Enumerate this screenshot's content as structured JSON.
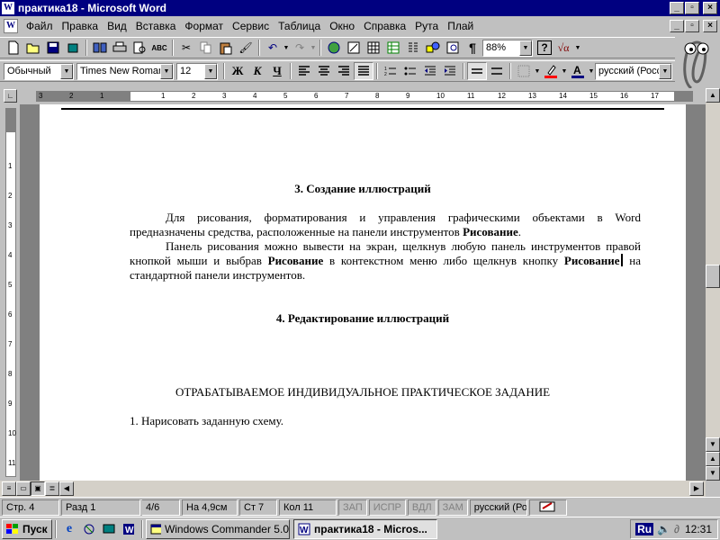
{
  "window": {
    "title": "практика18 - Microsoft Word",
    "icon": "word-icon"
  },
  "menu": [
    "Файл",
    "Правка",
    "Вид",
    "Вставка",
    "Формат",
    "Сервис",
    "Таблица",
    "Окно",
    "Справка",
    "Рута",
    "Плай"
  ],
  "standard_toolbar": {
    "zoom": "88%"
  },
  "format_toolbar": {
    "style": "Обычный",
    "font": "Times New Roman",
    "size": "12",
    "bold": "Ж",
    "italic": "К",
    "underline": "Ч",
    "language": "русский (Росс"
  },
  "document": {
    "heading1": "3. Создание иллюстраций",
    "para1": "Для рисования, форматирования и управления графическими объектами в Word предназначены средства, расположенные на панели инструментов",
    "para1_bold": "Рисование",
    "para2_a": "Панель рисования можно вывести на экран, щелкнув любую панель инструментов правой кнопкой мыши и выбрав",
    "para2_bold1": "Рисование",
    "para2_b": "в контекстном меню либо щелкнув кнопку",
    "para2_bold2": "Рисование",
    "para2_c": "на стандартной панели инструментов.",
    "heading2": "4. Редактирование иллюстраций",
    "heading3": "ОТРАБАТЫВАЕМОЕ  ИНДИВИДУАЛЬНОЕ ПРАКТИЧЕСКОЕ ЗАДАНИЕ",
    "item1": "1. Нарисовать заданную схему."
  },
  "status_bar": {
    "page": "Стр. 4",
    "section": "Разд 1",
    "pages": "4/6",
    "at": "На 4,9см",
    "line": "Ст 7",
    "col": "Кол 11",
    "rec": "ЗАП",
    "trk": "ИСПР",
    "ext": "ВДЛ",
    "ovr": "ЗАМ",
    "lang": "русский (Ро"
  },
  "taskbar": {
    "start": "Пуск",
    "task1": "Windows Commander 5.0",
    "task2": "практика18 - Micros...",
    "lang_indicator": "Ru",
    "clock": "12:31"
  },
  "colors": {
    "titlebar": "#000080",
    "face": "#c0c0c0",
    "highlight": "#ff0000"
  }
}
